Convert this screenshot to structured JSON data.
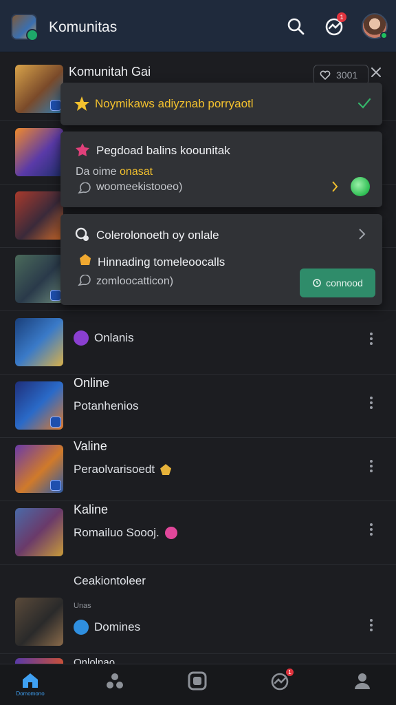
{
  "header": {
    "title": "Komunitas",
    "messages_badge": "1",
    "colors": {
      "bar": "#1f2a3c",
      "accent": "#3fa0f2",
      "online": "#1fc05e"
    }
  },
  "first_row": {
    "title": "Komunitah Gai",
    "pill_count": "3001"
  },
  "dropdown": {
    "item1": {
      "label": "Noymikaws adiyznab porryaotl"
    },
    "item2": {
      "title": "Pegdoad balins koounitak",
      "line_prefix": "Da oime",
      "line_highlight": "onasat",
      "meta": "woomeekistooeo)"
    },
    "item3": {
      "title": "Colerolonoeth oy onlale",
      "subtitle": "Hinnading tomeleoocalls",
      "meta": "zomloocatticon)",
      "button_label": "connood"
    }
  },
  "rows": [
    {
      "title": "",
      "subtitle": "Onlanis"
    },
    {
      "title": "Online",
      "subtitle": "Potanhenios"
    },
    {
      "title": "Valine",
      "subtitle": "Peraolvarisoedt"
    },
    {
      "title": "Kaline",
      "subtitle": "Romailuo Soooj."
    }
  ],
  "section": {
    "label": "Ceakiontoleer"
  },
  "last_row": {
    "tag": "Unas",
    "subtitle": "Domines"
  },
  "partial_row": {
    "title": "Onlolnao"
  },
  "tabbar": {
    "home_label": "Domomono",
    "badge": "1"
  }
}
